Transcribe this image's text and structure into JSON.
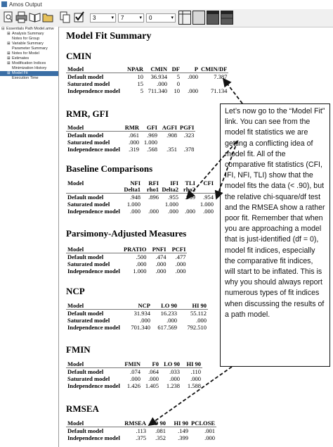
{
  "window": {
    "title": "Amos Output"
  },
  "toolbar": {
    "combo1": "3",
    "combo2": "7",
    "combo3": "0"
  },
  "tree": [
    {
      "label": "Essentials Path Model.amw",
      "indent": 0,
      "expander": "⊟",
      "selected": false
    },
    {
      "label": "Analysis Summary",
      "indent": 1,
      "expander": "⊞",
      "selected": false
    },
    {
      "label": "Notes for Group",
      "indent": 1,
      "expander": "",
      "selected": false
    },
    {
      "label": "Variable Summary",
      "indent": 1,
      "expander": "⊞",
      "selected": false
    },
    {
      "label": "Parameter Summary",
      "indent": 1,
      "expander": "",
      "selected": false
    },
    {
      "label": "Notes for Model",
      "indent": 1,
      "expander": "⊞",
      "selected": false
    },
    {
      "label": "Estimates",
      "indent": 1,
      "expander": "⊞",
      "selected": false
    },
    {
      "label": "Modification Indices",
      "indent": 1,
      "expander": "⊞",
      "selected": false
    },
    {
      "label": "Minimization History",
      "indent": 1,
      "expander": "",
      "selected": false
    },
    {
      "label": "Model Fit",
      "indent": 1,
      "expander": "⊞",
      "selected": true
    },
    {
      "label": "Execution Time",
      "indent": 1,
      "expander": "",
      "selected": false
    }
  ],
  "report": {
    "title": "Model Fit Summary",
    "cmin": {
      "heading": "CMIN",
      "columns": [
        "Model",
        "NPAR",
        "CMIN",
        "DF",
        "P",
        "CMIN/DF"
      ],
      "rows": [
        [
          "Default model",
          "10",
          "36.934",
          "5",
          ".000",
          "7.387"
        ],
        [
          "Saturated model",
          "15",
          ".000",
          "0",
          "",
          ""
        ],
        [
          "Independence model",
          "5",
          "711.340",
          "10",
          ".000",
          "71.134"
        ]
      ]
    },
    "rmr": {
      "heading": "RMR, GFI",
      "columns": [
        "Model",
        "RMR",
        "GFI",
        "AGFI",
        "PGFI"
      ],
      "rows": [
        [
          "Default model",
          ".061",
          ".969",
          ".908",
          ".323"
        ],
        [
          "Saturated model",
          ".000",
          "1.000",
          "",
          ""
        ],
        [
          "Independence model",
          ".319",
          ".568",
          ".351",
          ".378"
        ]
      ]
    },
    "baseline": {
      "heading": "Baseline Comparisons",
      "columns": [
        {
          "top": "Model",
          "bottom": ""
        },
        {
          "top": "NFI",
          "bottom": "Delta1"
        },
        {
          "top": "RFI",
          "bottom": "rho1"
        },
        {
          "top": "IFI",
          "bottom": "Delta2"
        },
        {
          "top": "TLI",
          "bottom": "rho2"
        },
        {
          "top": "CFI",
          "bottom": ""
        }
      ],
      "rows": [
        [
          "Default model",
          ".948",
          ".896",
          ".955",
          ".909",
          ".954"
        ],
        [
          "Saturated model",
          "1.000",
          "",
          "1.000",
          "",
          "1.000"
        ],
        [
          "Independence model",
          ".000",
          ".000",
          ".000",
          ".000",
          ".000"
        ]
      ]
    },
    "parsimony": {
      "heading": "Parsimony-Adjusted Measures",
      "columns": [
        "Model",
        "PRATIO",
        "PNFI",
        "PCFI"
      ],
      "rows": [
        [
          "Default model",
          ".500",
          ".474",
          ".477"
        ],
        [
          "Saturated model",
          ".000",
          ".000",
          ".000"
        ],
        [
          "Independence model",
          "1.000",
          ".000",
          ".000"
        ]
      ]
    },
    "ncp": {
      "heading": "NCP",
      "columns": [
        "Model",
        "NCP",
        "LO 90",
        "HI 90"
      ],
      "rows": [
        [
          "Default model",
          "31.934",
          "16.233",
          "55.112"
        ],
        [
          "Saturated model",
          ".000",
          ".000",
          ".000"
        ],
        [
          "Independence model",
          "701.340",
          "617.569",
          "792.510"
        ]
      ]
    },
    "fmin": {
      "heading": "FMIN",
      "columns": [
        "Model",
        "FMIN",
        "F0",
        "LO 90",
        "HI 90"
      ],
      "rows": [
        [
          "Default model",
          ".074",
          ".064",
          ".033",
          ".110"
        ],
        [
          "Saturated model",
          ".000",
          ".000",
          ".000",
          ".000"
        ],
        [
          "Independence model",
          "1.426",
          "1.405",
          "1.238",
          "1.588"
        ]
      ]
    },
    "rmsea": {
      "heading": "RMSEA",
      "columns": [
        "Model",
        "RMSEA",
        "LO 90",
        "HI 90",
        "PCLOSE"
      ],
      "rows": [
        [
          "Default model",
          ".113",
          ".081",
          ".149",
          ".001"
        ],
        [
          "Independence model",
          ".375",
          ".352",
          ".399",
          ".000"
        ]
      ]
    }
  },
  "callout": {
    "text": "Let’s now go to the “Model Fit” link. You can see from the model fit statistics we are getting a conflicting idea of model fit. All of the comparative fit statistics (CFI, IFI, NFI, TLI) show that the model fits the data (< .90), but the relative chi-square/df test and the RMSEA show a rather poor fit. Remember that when you are approaching a model that is just-identified (df = 0), model fit indices, especially the comparative fit indices, will start to be inflated. This is why you should always report numerous types of fit indices when discussing the results of a path model."
  }
}
